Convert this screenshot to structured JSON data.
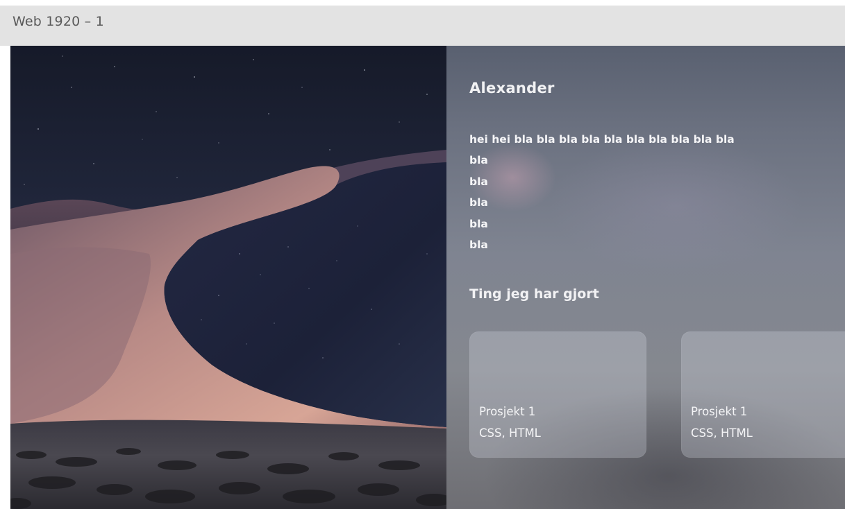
{
  "frame": {
    "label": "Web 1920 – 1"
  },
  "hero_image": {
    "description_icon": "desert-dune-night-image"
  },
  "profile": {
    "name": "Alexander",
    "bio_lines": [
      "hei hei bla bla bla bla bla bla bla bla bla bla",
      "bla",
      "bla",
      "bla",
      "bla",
      "bla"
    ]
  },
  "projects_section": {
    "title": "Ting jeg har gjort",
    "items": [
      {
        "name": "Prosjekt 1",
        "tech": "CSS, HTML"
      },
      {
        "name": "Prosjekt 1",
        "tech": "CSS, HTML"
      }
    ]
  },
  "colors": {
    "frame_bar": "#e3e3e3",
    "panel_text": "#f2f2f4",
    "night_sky": "#1c2233",
    "dune_light": "#c9958f"
  }
}
